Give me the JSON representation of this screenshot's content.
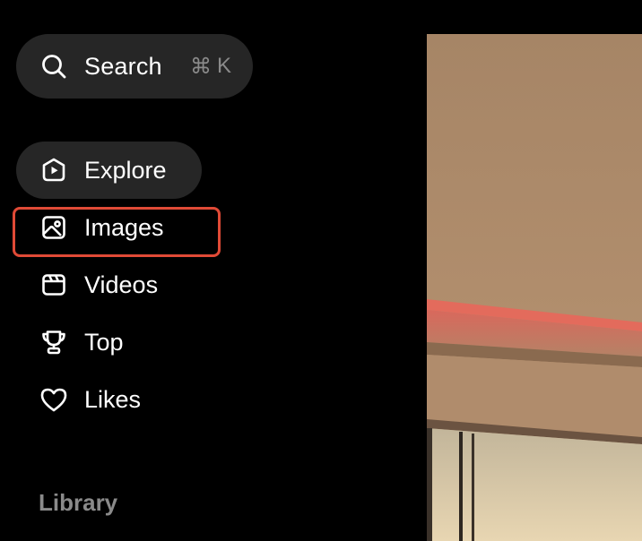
{
  "search": {
    "label": "Search",
    "shortcut_symbol": "⌘",
    "shortcut_key": "K",
    "icon": "search-icon"
  },
  "nav": {
    "items": [
      {
        "label": "Explore",
        "icon": "compass-play-icon",
        "active": true
      },
      {
        "label": "Images",
        "icon": "image-icon",
        "highlighted": true
      },
      {
        "label": "Videos",
        "icon": "video-icon"
      },
      {
        "label": "Top",
        "icon": "trophy-icon"
      },
      {
        "label": "Likes",
        "icon": "heart-icon"
      }
    ]
  },
  "library": {
    "title": "Library"
  },
  "colors": {
    "background": "#000000",
    "pill": "#262626",
    "muted_text": "#8a8a8a",
    "highlight_border": "#e04a36"
  }
}
